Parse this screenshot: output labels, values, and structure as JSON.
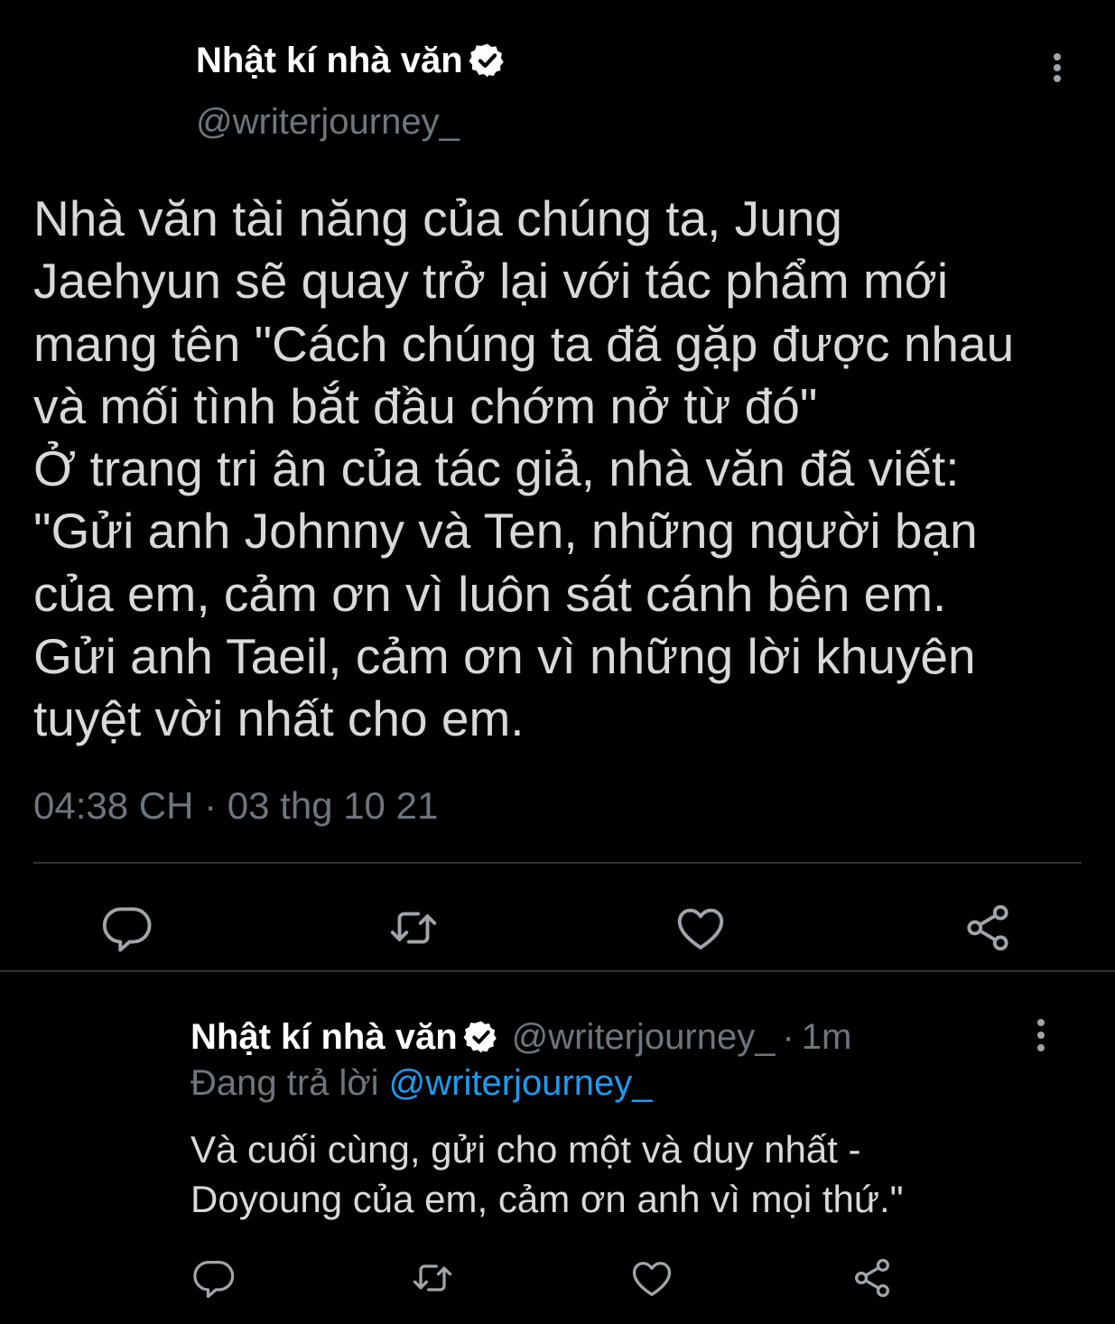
{
  "colors": {
    "background": "#000000",
    "text": "#d9d9d9",
    "name": "#ffffff",
    "muted": "#6e767d",
    "link": "#1d9bf0",
    "divider": "#2f3336",
    "verified_badge": "#ffffff"
  },
  "main_tweet": {
    "display_name": "Nhật kí nhà văn",
    "verified_icon": "verified-badge-icon",
    "handle": "@writerjourney_",
    "more_icon": "more-vertical-icon",
    "text": "Nhà văn tài năng của chúng ta, Jung\nJaehyun sẽ quay trở lại với tác phẩm mới\nmang tên \"Cách chúng ta đã gặp được nhau\nvà mối tình bắt đầu chớm nở từ đó\"\nỞ trang tri ân của tác giả, nhà văn đã viết:\n\"Gửi anh Johnny và Ten, những người bạn\ncủa em, cảm ơn vì luôn sát cánh bên em.\nGửi anh Taeil, cảm ơn vì những lời khuyên\ntuyệt vời nhất cho em.",
    "timestamp": "04:38 CH · 03 thg 10 21",
    "actions": [
      {
        "name": "reply",
        "icon": "reply-icon"
      },
      {
        "name": "retweet",
        "icon": "retweet-icon"
      },
      {
        "name": "like",
        "icon": "heart-icon"
      },
      {
        "name": "share",
        "icon": "share-icon"
      }
    ]
  },
  "reply_tweet": {
    "display_name": "Nhật kí nhà văn",
    "verified_icon": "verified-badge-icon",
    "handle": "@writerjourney_",
    "separator": "·",
    "time_ago": "1m",
    "more_icon": "more-vertical-icon",
    "replying_prefix": "Đang trả lời",
    "replying_to": "@writerjourney_",
    "text": "Và cuối cùng, gửi cho một và duy nhất -\nDoyoung của em, cảm ơn anh vì mọi thứ.\"",
    "actions": [
      {
        "name": "reply",
        "icon": "reply-icon"
      },
      {
        "name": "retweet",
        "icon": "retweet-icon"
      },
      {
        "name": "like",
        "icon": "heart-icon"
      },
      {
        "name": "share",
        "icon": "share-icon"
      }
    ]
  }
}
